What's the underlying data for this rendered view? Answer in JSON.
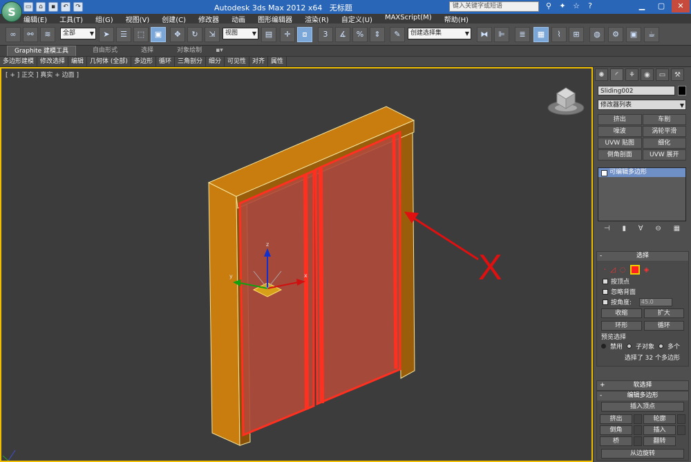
{
  "window": {
    "title": "Autodesk 3ds Max  2012 x64",
    "doc": "无标题",
    "search_placeholder": "键入关键字或短语"
  },
  "menu": [
    "编辑(E)",
    "工具(T)",
    "组(G)",
    "视图(V)",
    "创建(C)",
    "修改器",
    "动画",
    "图形编辑器",
    "渲染(R)",
    "自定义(U)",
    "MAXScript(M)",
    "帮助(H)"
  ],
  "toolbar": {
    "selection_filter": "全部",
    "ref_coord": "视图",
    "named_selection": "创建选择集",
    "snap_label": "3"
  },
  "ribbon": {
    "tabs": [
      "Graphite 建模工具",
      "自由形式",
      "选择",
      "对象绘制"
    ],
    "sub": [
      "多边形建模",
      "修改选择",
      "编辑",
      "几何体 (全部)",
      "多边形",
      "循环",
      "三角剖分",
      "细分",
      "可见性",
      "对齐",
      "属性"
    ]
  },
  "viewport": {
    "label": "[ + ] 正交 ] 真实 + 边面 ]",
    "axis_x": "x",
    "axis_y": "y",
    "axis_z": "z",
    "annotation": "X",
    "colors": {
      "frame": "#c87d0e",
      "frame_dark": "#8a5208",
      "panel": "#b04a3a",
      "highlight": "#ff3020",
      "border": "#f0c000"
    }
  },
  "command_panel": {
    "object_name": "Sliding002",
    "modifier_list": "修改器列表",
    "modifiers": [
      "挤出",
      "车削",
      "噪波",
      "涡轮平滑",
      "UVW 贴图",
      "细化",
      "倒角剖面",
      "UVW 展开"
    ],
    "stack_item": "可编辑多边形",
    "selection": {
      "title": "选择",
      "by_vertex": "按顶点",
      "ignore_backface": "忽略背面",
      "by_angle": "按角度:",
      "angle_value": "45.0",
      "shrink": "收缩",
      "grow": "扩大",
      "ring": "环形",
      "loop": "循环",
      "preview": "预览选择",
      "preview_options": [
        "禁用",
        "子对象",
        "多个"
      ],
      "status": "选择了 32 个多边形"
    },
    "soft_selection": "软选择",
    "edit_poly": {
      "title": "编辑多边形",
      "insert_vertex": "插入顶点",
      "buttons": [
        "挤出",
        "轮廓",
        "倒角",
        "插入",
        "桥",
        "翻转"
      ],
      "hinge": "从边旋转"
    }
  }
}
